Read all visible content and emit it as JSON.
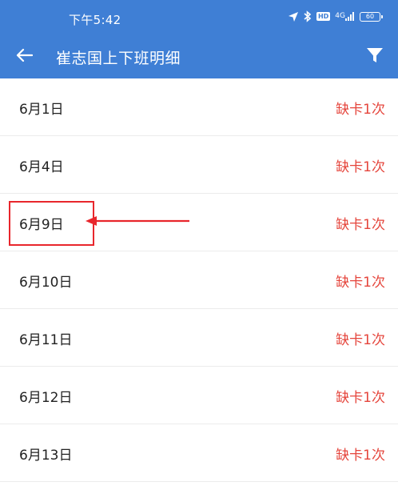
{
  "status_bar": {
    "time": "下午5:42",
    "network": "4G",
    "battery": "60"
  },
  "header": {
    "title": "崔志国上下班明细"
  },
  "records": [
    {
      "date": "6月1日",
      "status": "缺卡1次"
    },
    {
      "date": "6月4日",
      "status": "缺卡1次"
    },
    {
      "date": "6月9日",
      "status": "缺卡1次"
    },
    {
      "date": "6月10日",
      "status": "缺卡1次"
    },
    {
      "date": "6月11日",
      "status": "缺卡1次"
    },
    {
      "date": "6月12日",
      "status": "缺卡1次"
    },
    {
      "date": "6月13日",
      "status": "缺卡1次"
    }
  ],
  "colors": {
    "header_bg": "#3f7fd5",
    "status_text": "#e5453c",
    "annotation": "#e8262c"
  }
}
